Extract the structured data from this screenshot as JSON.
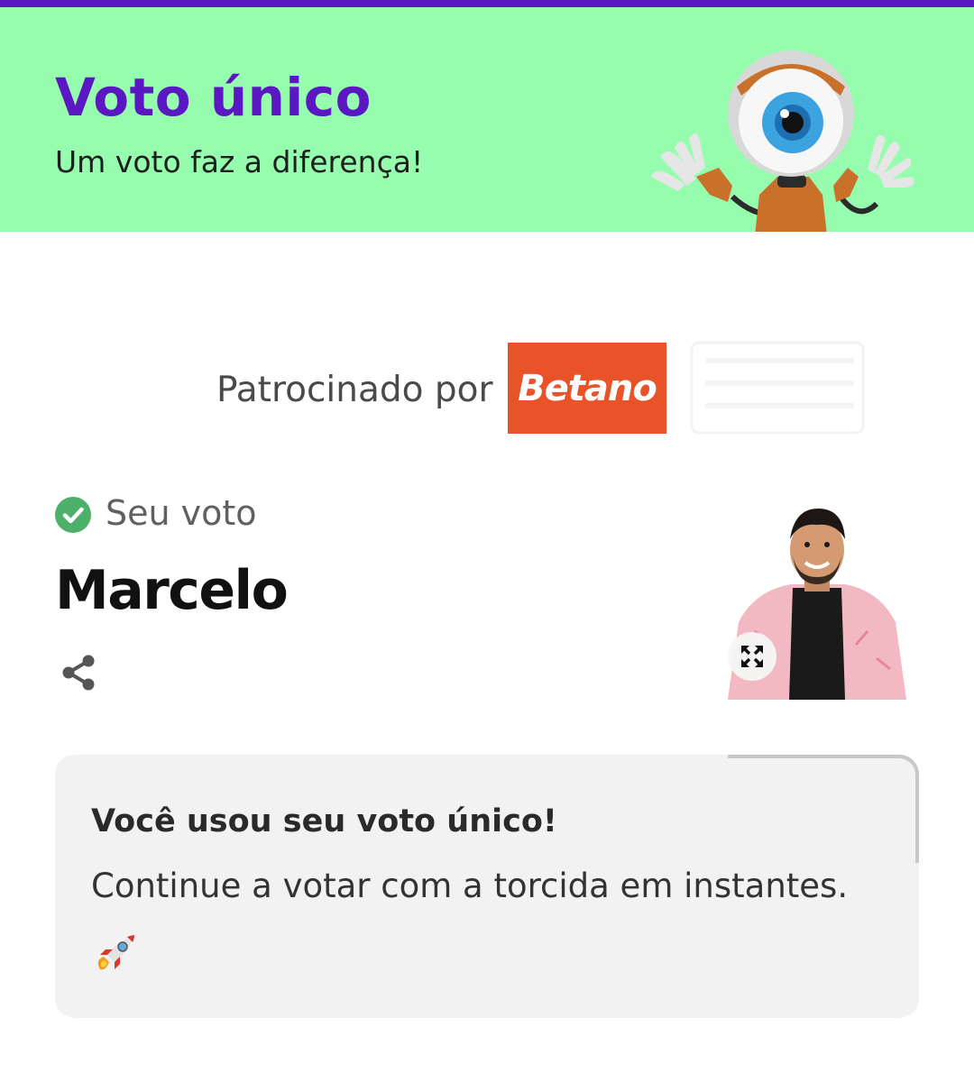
{
  "header": {
    "title": "Voto único",
    "subtitle": "Um voto faz a diferença!",
    "accent_color": "#5a17c2",
    "banner_color": "#96fcae",
    "mascot_icon": "big-brother-eye-mascot"
  },
  "sponsor": {
    "label": "Patrocinado por",
    "logo_text": "Betano",
    "logo_color": "#e8532a"
  },
  "vote": {
    "status_label": "Seu voto",
    "status_icon": "check-circle-icon",
    "status_color": "#4caf6a",
    "candidate_name": "Marcelo",
    "share_icon": "share-icon",
    "expand_icon": "expand-icon"
  },
  "notice": {
    "title": "Você usou seu voto único!",
    "message": "Continue a votar com a torcida em instantes.",
    "emoji_icon": "rocket-icon"
  }
}
